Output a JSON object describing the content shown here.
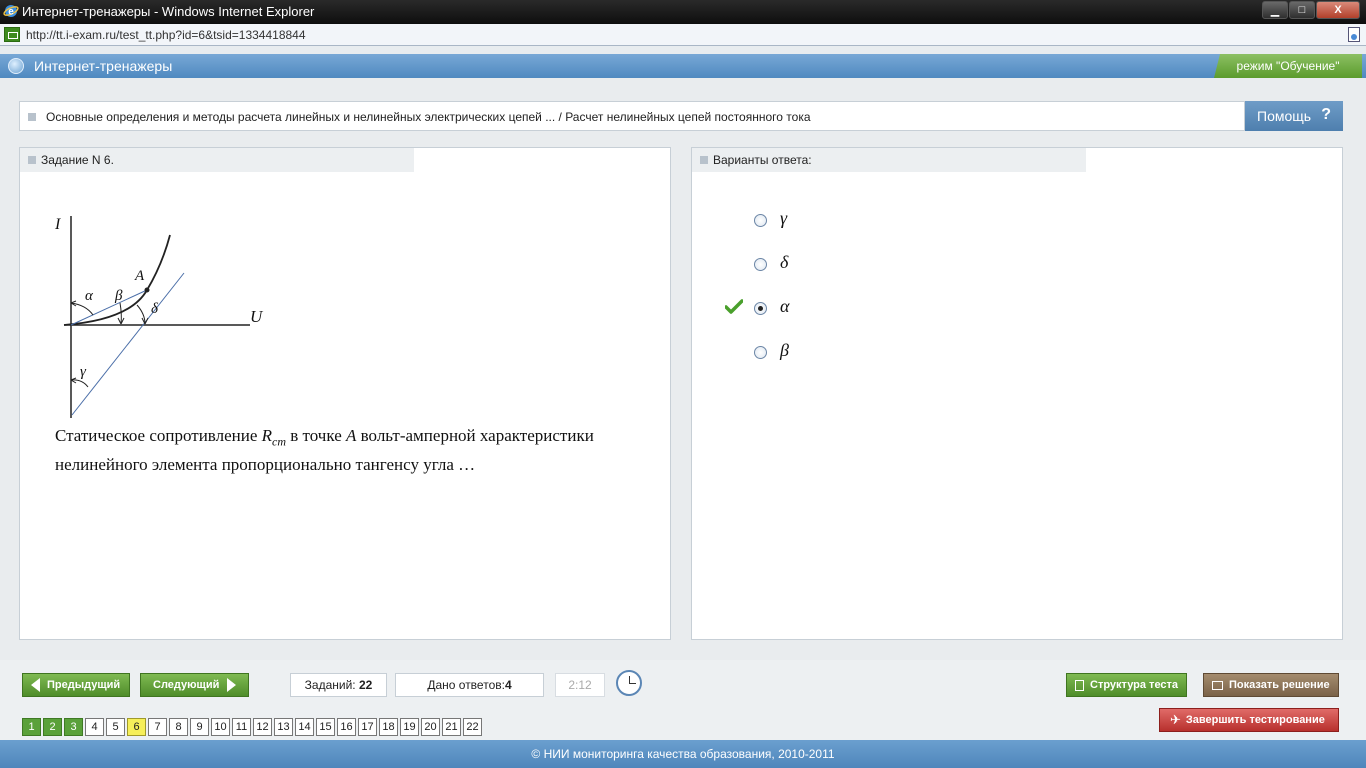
{
  "window": {
    "title": "Интернет-тренажеры - Windows Internet Explorer",
    "url": "http://tt.i-exam.ru/test_tt.php?id=6&tsid=1334418844",
    "minimize": "▁",
    "maximize": "□",
    "close": "X"
  },
  "app": {
    "title": "Интернет-тренажеры",
    "mode": "режим \"Обучение\""
  },
  "breadcrumb": "Основные определения и методы расчета линейных и нелинейных электрических цепей ... / Расчет нелинейных цепей постоянного тока",
  "help": {
    "label": "Помощь",
    "icon": "?"
  },
  "task": {
    "header": "Задание N 6.",
    "graph_labels": {
      "i": "I",
      "u": "U",
      "a": "A",
      "alpha": "α",
      "beta": "β",
      "delta": "δ",
      "gamma": "γ"
    },
    "question_part1": "Статическое сопротивление ",
    "question_math": "R",
    "question_sub": "ст",
    "question_part2": " в точке ",
    "question_point": "A",
    "question_part3": " вольт-амперной характеристики нелинейного элемента пропорционально тангенсу угла …"
  },
  "answers": {
    "header": "Варианты ответа:",
    "options": [
      {
        "label": "γ",
        "selected": false
      },
      {
        "label": "δ",
        "selected": false
      },
      {
        "label": "α",
        "selected": true,
        "checked": true
      },
      {
        "label": "β",
        "selected": false
      }
    ]
  },
  "toolbar": {
    "prev": "Предыдущий",
    "next": "Следующий",
    "tasks_label": "Заданий:",
    "tasks_count": "22",
    "answers_label": "Дано ответов:",
    "answers_count": "4",
    "timer": "2:12",
    "structure": "Структура теста",
    "show_solution": "Показать решение",
    "finish": "Завершить тестирование"
  },
  "pages": [
    {
      "n": "1",
      "state": "done"
    },
    {
      "n": "2",
      "state": "done"
    },
    {
      "n": "3",
      "state": "done"
    },
    {
      "n": "4",
      "state": ""
    },
    {
      "n": "5",
      "state": ""
    },
    {
      "n": "6",
      "state": "cur"
    },
    {
      "n": "7",
      "state": ""
    },
    {
      "n": "8",
      "state": ""
    },
    {
      "n": "9",
      "state": ""
    },
    {
      "n": "10",
      "state": ""
    },
    {
      "n": "11",
      "state": ""
    },
    {
      "n": "12",
      "state": ""
    },
    {
      "n": "13",
      "state": ""
    },
    {
      "n": "14",
      "state": ""
    },
    {
      "n": "15",
      "state": ""
    },
    {
      "n": "16",
      "state": ""
    },
    {
      "n": "17",
      "state": ""
    },
    {
      "n": "18",
      "state": ""
    },
    {
      "n": "19",
      "state": ""
    },
    {
      "n": "20",
      "state": ""
    },
    {
      "n": "21",
      "state": ""
    },
    {
      "n": "22",
      "state": ""
    }
  ],
  "footer": "© НИИ мониторинга качества образования, 2010-2011"
}
